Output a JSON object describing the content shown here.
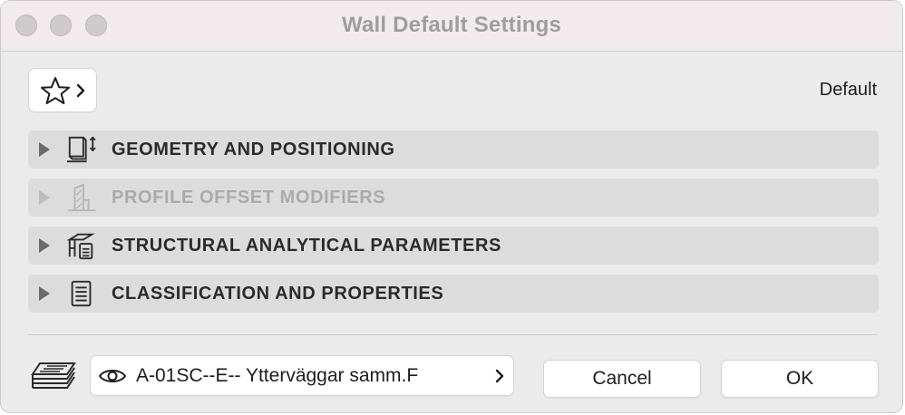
{
  "window": {
    "title": "Wall Default Settings"
  },
  "favorites": {
    "icon": "star-icon",
    "chevron": "chevron-right-icon"
  },
  "header": {
    "default_label": "Default"
  },
  "panels": [
    {
      "label": "GEOMETRY AND POSITIONING",
      "icon": "geometry-positioning-icon",
      "enabled": true
    },
    {
      "label": "PROFILE OFFSET MODIFIERS",
      "icon": "profile-offset-icon",
      "enabled": false
    },
    {
      "label": "STRUCTURAL ANALYTICAL PARAMETERS",
      "icon": "structural-analytical-icon",
      "enabled": true
    },
    {
      "label": "CLASSIFICATION AND PROPERTIES",
      "icon": "classification-properties-icon",
      "enabled": true
    }
  ],
  "footer": {
    "layer": {
      "icon": "layers-icon",
      "visibility_icon": "eye-icon",
      "value": "A-01SC--E-- Ytterväggar samm.F"
    },
    "cancel_label": "Cancel",
    "ok_label": "OK"
  },
  "colors": {
    "panel_bg": "#dcdcdc",
    "window_bg": "#ebebeb",
    "titlebar_bg": "#f1ebee",
    "disabled_text": "#aaaaaa"
  }
}
